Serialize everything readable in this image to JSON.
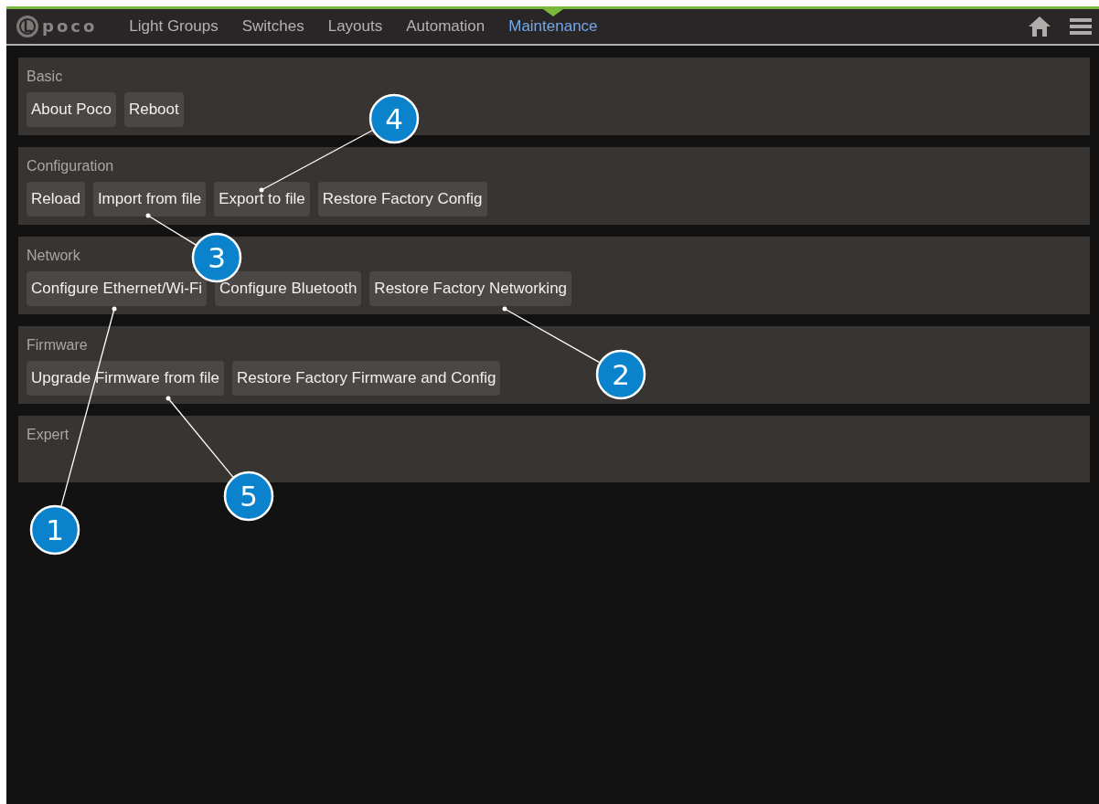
{
  "logo": {
    "text": "poco"
  },
  "tabs": [
    {
      "label": "Light Groups",
      "selected": false
    },
    {
      "label": "Switches",
      "selected": false
    },
    {
      "label": "Layouts",
      "selected": false
    },
    {
      "label": "Automation",
      "selected": false
    },
    {
      "label": "Maintenance",
      "selected": true
    }
  ],
  "sections": [
    {
      "title": "Basic",
      "buttons": [
        "About Poco",
        "Reboot"
      ]
    },
    {
      "title": "Configuration",
      "buttons": [
        "Reload",
        "Import from file",
        "Export to file",
        "Restore Factory Config"
      ]
    },
    {
      "title": "Network",
      "buttons": [
        "Configure Ethernet/Wi-Fi",
        "Configure Bluetooth",
        "Restore Factory Networking"
      ]
    },
    {
      "title": "Firmware",
      "buttons": [
        "Upgrade Firmware from file",
        "Restore Factory Firmware and Config"
      ]
    },
    {
      "title": "Expert"
    }
  ],
  "callouts": [
    {
      "label": "1"
    },
    {
      "label": "2"
    },
    {
      "label": "3"
    },
    {
      "label": "4"
    },
    {
      "label": "5"
    }
  ]
}
